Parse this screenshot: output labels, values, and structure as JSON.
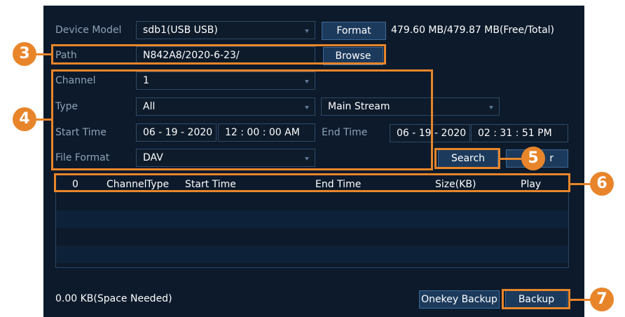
{
  "device_model": {
    "label": "Device Model",
    "value": "sdb1(USB USB)"
  },
  "format_button": "Format",
  "capacity": "479.60 MB/479.87 MB(Free/Total)",
  "path": {
    "label": "Path",
    "value": "N842A8/2020-6-23/"
  },
  "browse_button": "Browse",
  "channel": {
    "label": "Channel",
    "value": "1"
  },
  "type": {
    "label": "Type",
    "value": "All",
    "stream": "Main Stream"
  },
  "start_time": {
    "label": "Start Time",
    "date": "06 - 19 - 2020",
    "time": "12 : 00 : 00 AM"
  },
  "end_time": {
    "label": "End Time",
    "date": "06 - 19 - 2020",
    "time": "02 : 31 : 51 PM"
  },
  "file_format": {
    "label": "File Format",
    "value": "DAV"
  },
  "search_button": "Search",
  "clear_button": "r",
  "table": {
    "headers": {
      "select": "0",
      "channel": "Channel",
      "type": "Type",
      "start": "Start Time",
      "end": "End Time",
      "size": "Size(KB)",
      "play": "Play"
    },
    "rows": []
  },
  "space_needed": "0.00 KB(Space Needed)",
  "onekey_backup_button": "Onekey Backup",
  "backup_button": "Backup",
  "callouts": {
    "c3": "3",
    "c4": "4",
    "c5": "5",
    "c6": "6",
    "c7": "7"
  },
  "colors": {
    "panel": "#0c1a2b",
    "row_alt": "#0d2238",
    "accent": "#e8852a",
    "button": "#1c3a5c"
  }
}
